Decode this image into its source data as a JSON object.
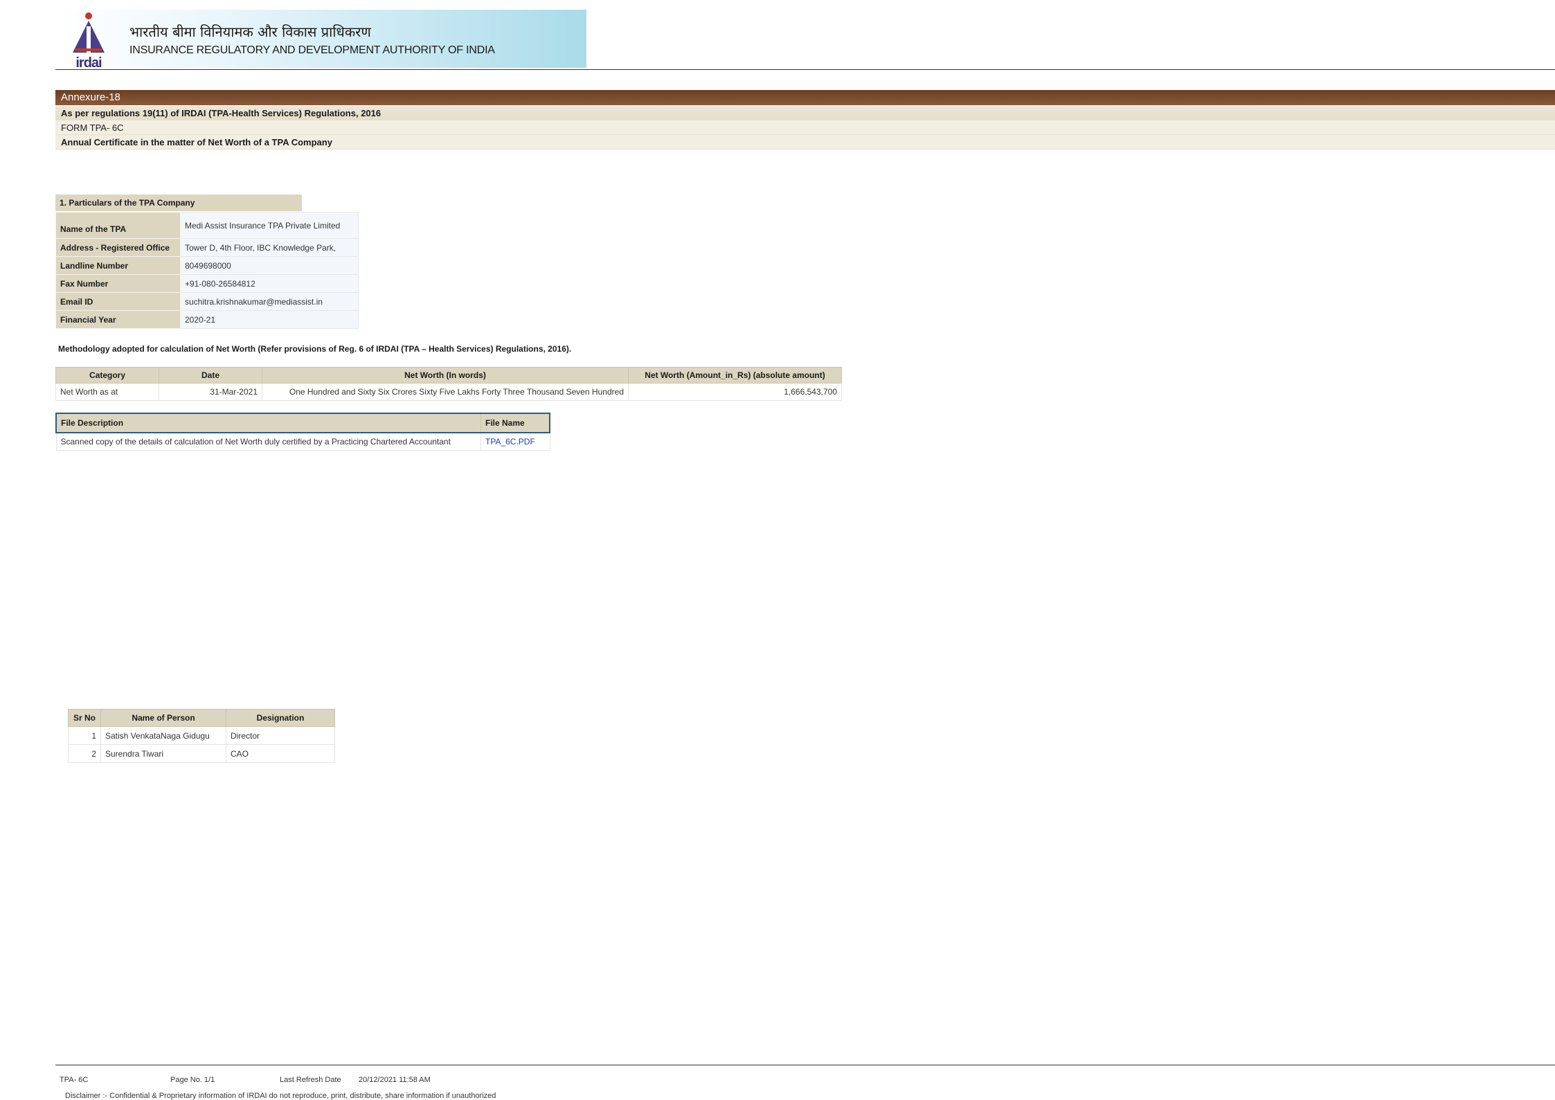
{
  "header": {
    "hindi_title": "भारतीय बीमा विनियामक और विकास प्राधिकरण",
    "english_title": "INSURANCE REGULATORY AND DEVELOPMENT AUTHORITY OF INDIA",
    "logo_text": "irdai",
    "logo_icon": "irdai-emblem-icon"
  },
  "annexure": {
    "title": "Annexure-18",
    "regulation": "As per regulations 19(11) of IRDAI (TPA-Health Services) Regulations, 2016",
    "form": "FORM TPA- 6C",
    "certificate": "Annual Certificate in the matter of Net Worth of a TPA Company"
  },
  "particulars": {
    "heading": "1. Particulars of the TPA Company",
    "rows": [
      {
        "label": "Name of the TPA",
        "value": "Medi Assist Insurance TPA Private Limited"
      },
      {
        "label": "Address - Registered Office",
        "value": "Tower D, 4th Floor, IBC Knowledge Park,"
      },
      {
        "label": "Landline Number",
        "value": "8049698000"
      },
      {
        "label": "Fax Number",
        "value": "+91-080-26584812"
      },
      {
        "label": "Email ID",
        "value": "suchitra.krishnakumar@mediassist.in"
      },
      {
        "label": "Financial Year",
        "value": "2020-21"
      }
    ]
  },
  "methodology": "Methodology adopted for calculation of Net Worth (Refer  provisions of Reg. 6 of IRDAI (TPA – Health Services) Regulations, 2016).",
  "networth": {
    "headers": [
      "Category",
      "Date",
      "Net Worth (In words)",
      "Net Worth (Amount_in_Rs) (absolute amount)"
    ],
    "row": {
      "category": "Net Worth as at",
      "date": "31-Mar-2021",
      "words": "One Hundred and Sixty Six Crores Sixty Five Lakhs Forty Three Thousand Seven Hundred",
      "amount": "1,666,543,700"
    }
  },
  "files": {
    "headers": [
      "File Description",
      "File Name"
    ],
    "row": {
      "description": "Scanned copy of the details of calculation of Net Worth duly certified by a Practicing Chartered Accountant",
      "file_name": "TPA_6C.PDF"
    }
  },
  "signatories": {
    "headers": [
      "Sr No",
      "Name of Person",
      "Designation"
    ],
    "rows": [
      {
        "sr": "1",
        "name": "Satish VenkataNaga Gidugu",
        "designation": "Director"
      },
      {
        "sr": "2",
        "name": "Surendra Tiwari",
        "designation": "CAO"
      }
    ]
  },
  "footer": {
    "form": "TPA- 6C",
    "page": "Page No. 1/1",
    "refresh_label": "Last Refresh Date",
    "refresh_date": "20/12/2021 11:58 AM",
    "disclaimer": "Disclaimer :- Confidential & Proprietary information of IRDAI do not reproduce, print, distribute, share information if unauthorized"
  },
  "colors": {
    "band_brown": "#6a3f22",
    "label_beige": "#dcd6c0",
    "link_blue": "#1c3fa8",
    "file_header_border": "#2c5a8a"
  }
}
